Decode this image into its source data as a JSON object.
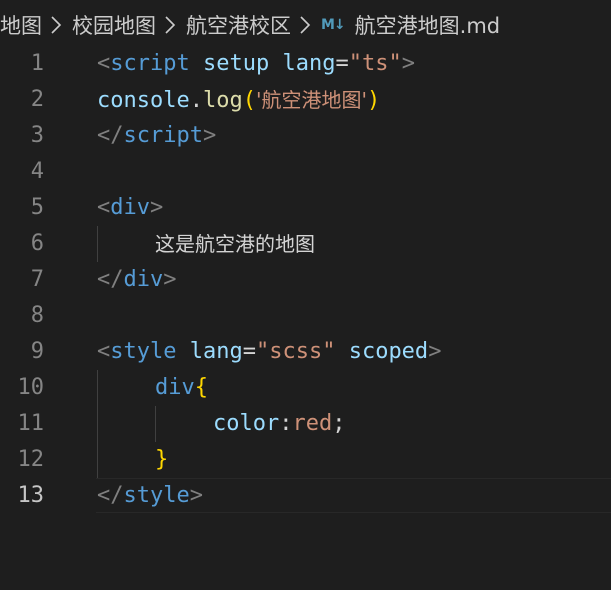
{
  "breadcrumb": {
    "items": [
      {
        "label": "地图"
      },
      {
        "label": "校园地图"
      },
      {
        "label": "航空港校区"
      }
    ],
    "file_icon": "M↓",
    "file_name": "航空港地图.md"
  },
  "editor": {
    "current_line": 13,
    "lines": [
      {
        "num": "1",
        "tokens": [
          "<",
          "script",
          " ",
          "setup",
          " ",
          "lang",
          "=",
          "\"ts\"",
          ">"
        ]
      },
      {
        "num": "2",
        "tokens": [
          "console",
          ".",
          "log",
          "(",
          "'航空港地图'",
          ")"
        ]
      },
      {
        "num": "3",
        "tokens": [
          "</",
          "script",
          ">"
        ]
      },
      {
        "num": "4",
        "tokens": []
      },
      {
        "num": "5",
        "tokens": [
          "<",
          "div",
          ">"
        ]
      },
      {
        "num": "6",
        "tokens": [
          "这是航空港的地图"
        ]
      },
      {
        "num": "7",
        "tokens": [
          "</",
          "div",
          ">"
        ]
      },
      {
        "num": "8",
        "tokens": []
      },
      {
        "num": "9",
        "tokens": [
          "<",
          "style",
          " ",
          "lang",
          "=",
          "\"scss\"",
          " ",
          "scoped",
          ">"
        ]
      },
      {
        "num": "10",
        "tokens": [
          "div",
          "{"
        ]
      },
      {
        "num": "11",
        "tokens": [
          "color",
          ":",
          "red",
          ";"
        ]
      },
      {
        "num": "12",
        "tokens": [
          "}"
        ]
      },
      {
        "num": "13",
        "tokens": [
          "</",
          "style",
          ">"
        ]
      }
    ]
  },
  "colors": {
    "background": "#1e1e1e",
    "tag_bracket": "#808080",
    "tag_name": "#569cd6",
    "attribute": "#9cdcfe",
    "string": "#ce9178",
    "function": "#dcdcaa",
    "bracket": "#ffd700"
  }
}
